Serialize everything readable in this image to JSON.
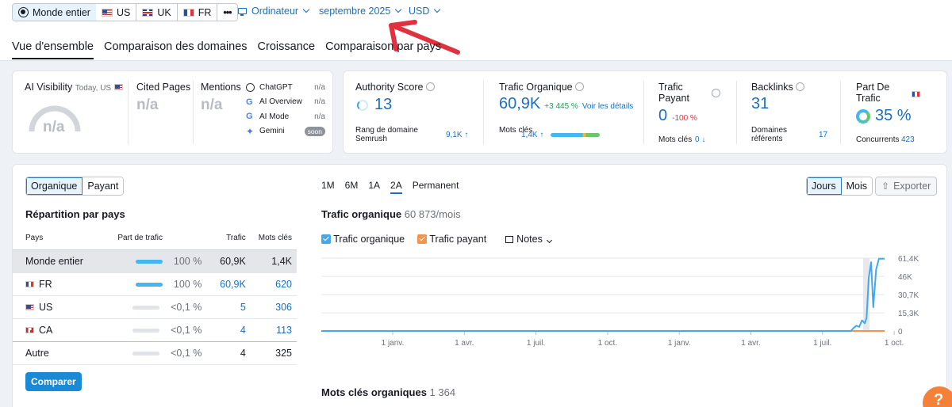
{
  "header": {
    "regions": [
      {
        "label": "Monde entier",
        "flag": "globe"
      },
      {
        "label": "US",
        "flag": "us"
      },
      {
        "label": "UK",
        "flag": "uk"
      },
      {
        "label": "FR",
        "flag": "fr"
      },
      {
        "label": "•••"
      }
    ],
    "device": "Ordinateur",
    "date": "septembre 2025",
    "currency": "USD",
    "tabs": [
      "Vue d'ensemble",
      "Comparaison des domaines",
      "Croissance",
      "Comparaison par pays"
    ]
  },
  "ai_card": {
    "title": "AI Visibility",
    "subtitle": "Today, US",
    "gauge_value": "n/a",
    "cited_pages_label": "Cited Pages",
    "cited_pages_value": "n/a",
    "mentions_label": "Mentions",
    "mentions_value": "n/a",
    "platforms": [
      {
        "name": "ChatGPT",
        "value": "n/a"
      },
      {
        "name": "AI Overview",
        "value": "n/a"
      },
      {
        "name": "AI Mode",
        "value": "n/a"
      },
      {
        "name": "Gemini",
        "value": "soon"
      }
    ]
  },
  "metrics": {
    "authority": {
      "label": "Authority Score",
      "value": "13",
      "sub_label": "Rang de domaine Semrush",
      "sub_value": "9,1K ↑"
    },
    "organic": {
      "label": "Trafic Organique",
      "value": "60,9K",
      "delta": "+3 445 %",
      "link": "Voir les détails",
      "sub_label": "Mots clés",
      "sub_value": "1,4K ↑"
    },
    "paid": {
      "label": "Trafic Payant",
      "value": "0",
      "delta": "-100 %",
      "sub_label": "Mots clés",
      "sub_value": "0 ↓"
    },
    "backlinks": {
      "label": "Backlinks",
      "value": "31",
      "sub_label": "Domaines référents",
      "sub_value": "17"
    },
    "share": {
      "label": "Part De Trafic",
      "value": "35 %",
      "sub_label": "Concurrents",
      "sub_value": "423"
    }
  },
  "left_panel": {
    "toggle": [
      "Organique",
      "Payant"
    ],
    "title": "Répartition par pays",
    "columns": [
      "Pays",
      "Part de trafic",
      "Trafic",
      "Mots clés"
    ],
    "rows": [
      {
        "country": "Monde entier",
        "flag": "",
        "share": "100 %",
        "share_fill": 1,
        "traffic": "60,9K",
        "keywords": "1,4K",
        "linked": false
      },
      {
        "country": "FR",
        "flag": "fr",
        "share": "100 %",
        "share_fill": 1,
        "traffic": "60,9K",
        "keywords": "620",
        "linked": true
      },
      {
        "country": "US",
        "flag": "us",
        "share": "<0,1 %",
        "share_fill": 0,
        "traffic": "5",
        "keywords": "306",
        "linked": true
      },
      {
        "country": "CA",
        "flag": "ca",
        "share": "<0,1 %",
        "share_fill": 0,
        "traffic": "4",
        "keywords": "113",
        "linked": true
      },
      {
        "country": "Autre",
        "flag": "",
        "share": "<0,1 %",
        "share_fill": 0,
        "traffic": "4",
        "keywords": "325",
        "linked": false
      }
    ],
    "compare_button": "Comparer"
  },
  "chart_panel": {
    "periods": [
      "1M",
      "6M",
      "1A",
      "2A",
      "Permanent"
    ],
    "active_period": "2A",
    "granularity": [
      "Jours",
      "Mois"
    ],
    "export_label": "Exporter",
    "title": "Trafic organique",
    "title_value": "60 873/mois",
    "legend_organic": "Trafic organique",
    "legend_paid": "Trafic payant",
    "notes_label": "Notes",
    "keywords_title": "Mots clés organiques",
    "keywords_value": "1 364"
  },
  "chart_data": {
    "type": "line",
    "title": "Trafic organique",
    "xlabel": "",
    "ylabel": "",
    "ylim": [
      0,
      61400
    ],
    "yticks": [
      "61,4K",
      "46K",
      "30,7K",
      "15,3K",
      "0"
    ],
    "ytick_values": [
      61400,
      46000,
      30700,
      15300,
      0
    ],
    "xticks": [
      "1 janv.",
      "1 avr.",
      "1 juil.",
      "1 oct.",
      "1 janv.",
      "1 avr.",
      "1 juil.",
      "1 oct."
    ],
    "grid": true,
    "series": [
      {
        "name": "Trafic organique",
        "color": "#44a8ea",
        "points": [
          [
            0,
            0
          ],
          [
            0.94,
            0
          ],
          [
            0.945,
            2500
          ],
          [
            0.95,
            4500
          ],
          [
            0.955,
            3500
          ],
          [
            0.96,
            9000
          ],
          [
            0.965,
            6500
          ],
          [
            0.968,
            11000
          ],
          [
            0.972,
            45000
          ],
          [
            0.976,
            58000
          ],
          [
            0.98,
            20000
          ],
          [
            0.985,
            52000
          ],
          [
            0.99,
            60900
          ],
          [
            1.0,
            60900
          ]
        ]
      },
      {
        "name": "Trafic payant",
        "color": "#f4934a",
        "points": [
          [
            0,
            0
          ],
          [
            0.95,
            0
          ],
          [
            1.0,
            0
          ]
        ]
      }
    ]
  },
  "colors": {
    "accent": "#1a6fc0",
    "organic": "#44a8ea",
    "paid": "#f4934a",
    "compare_btn": "#1a8ad4",
    "red": "#e0313e"
  }
}
